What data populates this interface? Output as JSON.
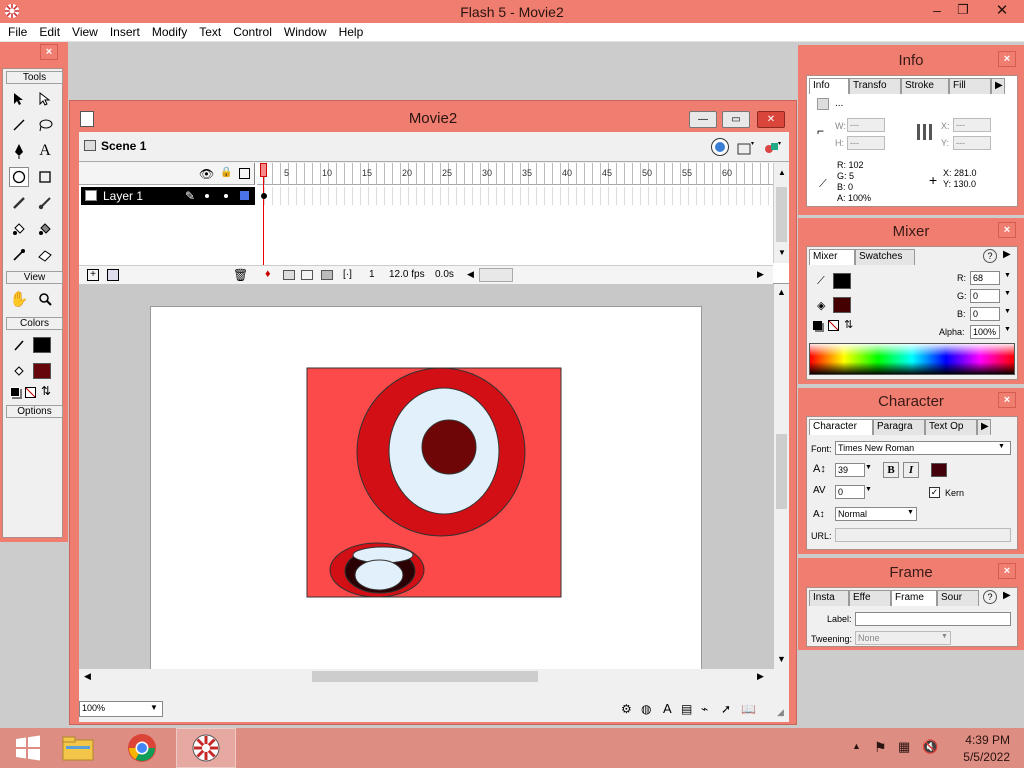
{
  "app": {
    "title": "Flash 5 - Movie2"
  },
  "menu": [
    "File",
    "Edit",
    "View",
    "Insert",
    "Modify",
    "Text",
    "Control",
    "Window",
    "Help"
  ],
  "tools": {
    "header": "Tools",
    "view_label": "View",
    "colors_label": "Colors",
    "options_label": "Options",
    "stroke_color": "#000000",
    "fill_color": "#66050a"
  },
  "movie": {
    "title": "Movie2",
    "scene": "Scene 1",
    "layer": "Layer 1",
    "ruler": [
      "5",
      "10",
      "15",
      "20",
      "25",
      "30",
      "35",
      "40",
      "45",
      "50",
      "55",
      "60"
    ],
    "frame": "1",
    "fps": "12.0 fps",
    "time": "0.0s",
    "zoom": "100%"
  },
  "info": {
    "title": "Info",
    "tabs": [
      "Info",
      "Transfo",
      "Stroke",
      "Fill"
    ],
    "dots": "...",
    "w_label": "W:",
    "w": "---",
    "h_label": "H:",
    "h": "---",
    "x_label": "X:",
    "x": "---",
    "y_label": "Y:",
    "y": "---",
    "r": "R: 102",
    "g": "G: 5",
    "b": "B: 0",
    "a": "A: 100%",
    "cx": "X: 281.0",
    "cy": "Y: 130.0"
  },
  "mixer": {
    "title": "Mixer",
    "tabs": [
      "Mixer",
      "Swatches"
    ],
    "r_label": "R:",
    "r": "68",
    "g_label": "G:",
    "g": "0",
    "b_label": "B:",
    "b": "0",
    "alpha_label": "Alpha:",
    "alpha": "100%",
    "stroke_color": "#000000",
    "fill_color": "#440000"
  },
  "character": {
    "title": "Character",
    "tabs": [
      "Character",
      "Paragra",
      "Text Op"
    ],
    "font_label": "Font:",
    "font": "Times New Roman",
    "size": "39",
    "tracking": "0",
    "bold": "B",
    "italic": "I",
    "kern": "Kern",
    "baseline": "Normal",
    "url_label": "URL:",
    "text_color": "#44000a"
  },
  "frame_panel": {
    "title": "Frame",
    "tabs": [
      "Insta",
      "Effe",
      "Frame",
      "Sour"
    ],
    "label_label": "Label:",
    "tweening_label": "Tweening:",
    "tweening": "None"
  },
  "taskbar": {
    "time": "4:39 PM",
    "date": "5/5/2022"
  }
}
